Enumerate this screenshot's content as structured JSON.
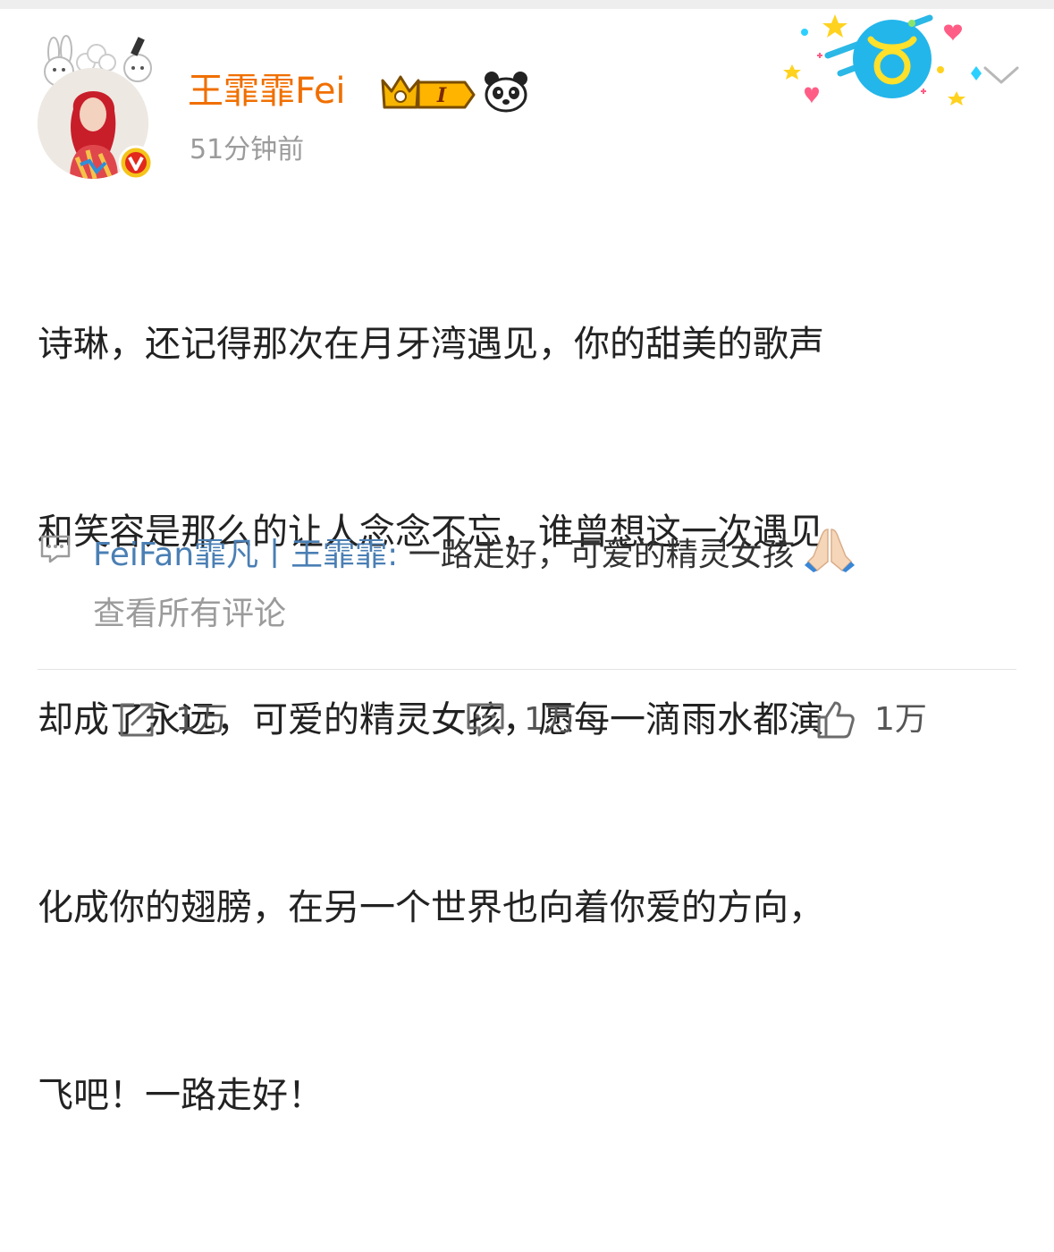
{
  "post": {
    "user_name": "王霏霏Fei",
    "time": "51分钟前",
    "text_lines": [
      "诗琳，还记得那次在月牙湾遇见，你的甜美的歌声",
      "和笑容是那么的让人念念不忘，谁曾想这一次遇见",
      "却成了永远，可爱的精灵女孩，愿每一滴雨水都演",
      "化成你的翅膀，在另一个世界也向着你爱的方向，",
      "飞吧！一路走好！"
    ],
    "badges": {
      "level": "I"
    }
  },
  "comment_preview": {
    "author": "FeiFan霏凡丨王霏霏",
    "colon": ":",
    "text": " 一路走好，可爱的精灵女孩",
    "view_all": "查看所有评论"
  },
  "actions": {
    "repost_count": "1万",
    "comment_count": "1万",
    "like_count": "1万"
  },
  "colors": {
    "username": "#f06f00",
    "link": "#4a7fb4",
    "muted": "#9b9b9b"
  }
}
